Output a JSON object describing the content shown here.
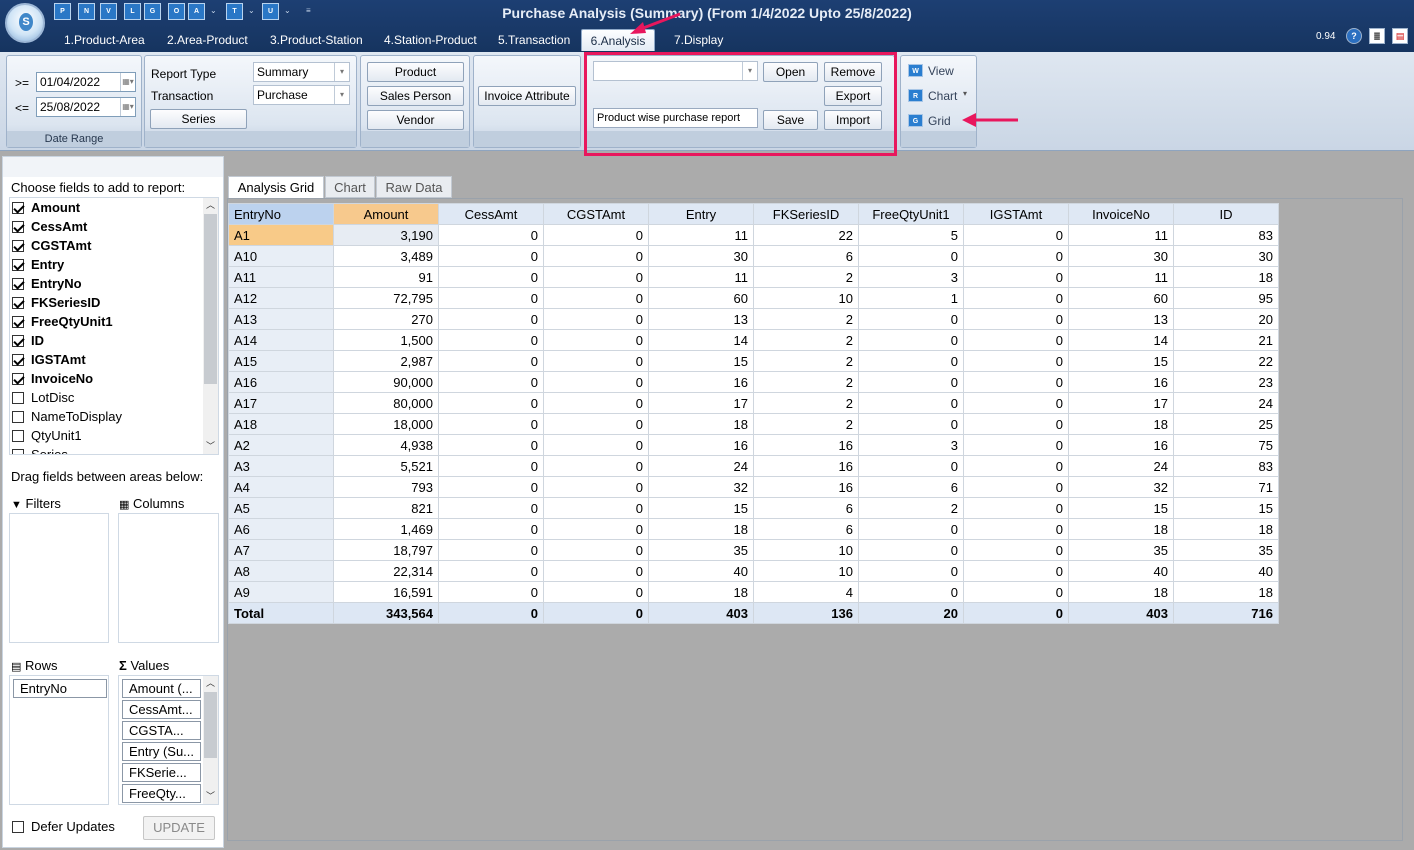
{
  "window": {
    "title": "Purchase Analysis (Summary) (From 1/4/2022 Upto 25/8/2022)",
    "version": "0.94",
    "quick_access": [
      "P",
      "N",
      "V",
      "L",
      "G",
      "O",
      "A",
      "T",
      "U"
    ]
  },
  "tabs": [
    {
      "label": "1.Product-Area"
    },
    {
      "label": "2.Area-Product"
    },
    {
      "label": "3.Product-Station"
    },
    {
      "label": "4.Station-Product"
    },
    {
      "label": "5.Transaction"
    },
    {
      "label": "6.Analysis",
      "active": true
    },
    {
      "label": "7.Display"
    }
  ],
  "date_range": {
    "group_label": "Date Range",
    "from_op": ">=",
    "from": "01/04/2022",
    "to_op": "<=",
    "to": "25/08/2022"
  },
  "report": {
    "report_type_label": "Report Type",
    "report_type": "Summary",
    "transaction_label": "Transaction",
    "transaction": "Purchase",
    "series_button": "Series"
  },
  "filter_buttons": {
    "product": "Product",
    "sales_person": "Sales Person",
    "vendor": "Vendor",
    "invoice_attribute": "Invoice Attribute"
  },
  "layout_group": {
    "layout_select": "",
    "open": "Open",
    "remove": "Remove",
    "export": "Export",
    "report_name": "Product wise purchase report",
    "save": "Save",
    "import": "Import"
  },
  "view_group": {
    "view": "View",
    "view_icon": "W",
    "chart": "Chart",
    "chart_icon": "R",
    "grid": "Grid",
    "grid_icon": "G"
  },
  "field_chooser": {
    "heading": "Choose fields to add to report:",
    "fields": [
      {
        "name": "Amount",
        "checked": true
      },
      {
        "name": "CessAmt",
        "checked": true
      },
      {
        "name": "CGSTAmt",
        "checked": true
      },
      {
        "name": "Entry",
        "checked": true
      },
      {
        "name": "EntryNo",
        "checked": true
      },
      {
        "name": "FKSeriesID",
        "checked": true
      },
      {
        "name": "FreeQtyUnit1",
        "checked": true
      },
      {
        "name": "ID",
        "checked": true
      },
      {
        "name": "IGSTAmt",
        "checked": true
      },
      {
        "name": "InvoiceNo",
        "checked": true
      },
      {
        "name": "LotDisc",
        "checked": false
      },
      {
        "name": "NameToDisplay",
        "checked": false
      },
      {
        "name": "QtyUnit1",
        "checked": false
      },
      {
        "name": "Series",
        "checked": false
      }
    ],
    "drag_heading": "Drag fields between areas below:",
    "filters_label": "Filters",
    "columns_label": "Columns",
    "rows_label": "Rows",
    "values_label": "Values",
    "rows_items": [
      "EntryNo"
    ],
    "values_items": [
      "Amount (...",
      "CessAmt...",
      "CGSTA...",
      "Entry (Su...",
      "FKSerie...",
      "FreeQty..."
    ],
    "defer_label": "Defer Updates",
    "update_button": "UPDATE"
  },
  "grid_tabs": [
    {
      "label": "Analysis Grid",
      "active": true
    },
    {
      "label": "Chart"
    },
    {
      "label": "Raw Data"
    }
  ],
  "grid": {
    "columns": [
      "EntryNo",
      "Amount",
      "CessAmt",
      "CGSTAmt",
      "Entry",
      "FKSeriesID",
      "FreeQtyUnit1",
      "IGSTAmt",
      "InvoiceNo",
      "ID"
    ],
    "rows": [
      [
        "A1",
        "3,190",
        "0",
        "0",
        "11",
        "22",
        "5",
        "0",
        "11",
        "83"
      ],
      [
        "A10",
        "3,489",
        "0",
        "0",
        "30",
        "6",
        "0",
        "0",
        "30",
        "30"
      ],
      [
        "A11",
        "91",
        "0",
        "0",
        "11",
        "2",
        "3",
        "0",
        "11",
        "18"
      ],
      [
        "A12",
        "72,795",
        "0",
        "0",
        "60",
        "10",
        "1",
        "0",
        "60",
        "95"
      ],
      [
        "A13",
        "270",
        "0",
        "0",
        "13",
        "2",
        "0",
        "0",
        "13",
        "20"
      ],
      [
        "A14",
        "1,500",
        "0",
        "0",
        "14",
        "2",
        "0",
        "0",
        "14",
        "21"
      ],
      [
        "A15",
        "2,987",
        "0",
        "0",
        "15",
        "2",
        "0",
        "0",
        "15",
        "22"
      ],
      [
        "A16",
        "90,000",
        "0",
        "0",
        "16",
        "2",
        "0",
        "0",
        "16",
        "23"
      ],
      [
        "A17",
        "80,000",
        "0",
        "0",
        "17",
        "2",
        "0",
        "0",
        "17",
        "24"
      ],
      [
        "A18",
        "18,000",
        "0",
        "0",
        "18",
        "2",
        "0",
        "0",
        "18",
        "25"
      ],
      [
        "A2",
        "4,938",
        "0",
        "0",
        "16",
        "16",
        "3",
        "0",
        "16",
        "75"
      ],
      [
        "A3",
        "5,521",
        "0",
        "0",
        "24",
        "16",
        "0",
        "0",
        "24",
        "83"
      ],
      [
        "A4",
        "793",
        "0",
        "0",
        "32",
        "16",
        "6",
        "0",
        "32",
        "71"
      ],
      [
        "A5",
        "821",
        "0",
        "0",
        "15",
        "6",
        "2",
        "0",
        "15",
        "15"
      ],
      [
        "A6",
        "1,469",
        "0",
        "0",
        "18",
        "6",
        "0",
        "0",
        "18",
        "18"
      ],
      [
        "A7",
        "18,797",
        "0",
        "0",
        "35",
        "10",
        "0",
        "0",
        "35",
        "35"
      ],
      [
        "A8",
        "22,314",
        "0",
        "0",
        "40",
        "10",
        "0",
        "0",
        "40",
        "40"
      ],
      [
        "A9",
        "16,591",
        "0",
        "0",
        "18",
        "4",
        "0",
        "0",
        "18",
        "18"
      ]
    ],
    "total": [
      "Total",
      "343,564",
      "0",
      "0",
      "403",
      "136",
      "20",
      "0",
      "403",
      "716"
    ]
  },
  "colors": {
    "annotation": "#e8175d",
    "title_bar": "#1d3f73",
    "selected_header": "#f7c98d"
  }
}
